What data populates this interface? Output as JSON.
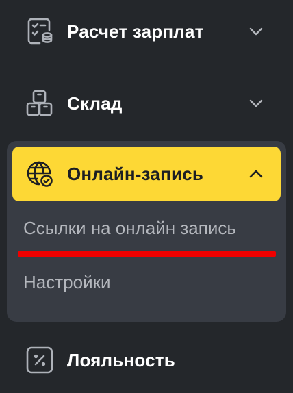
{
  "menu": {
    "salary": {
      "label": "Расчет зарплат",
      "icon": "payroll-list-icon",
      "expanded": false
    },
    "warehouse": {
      "label": "Склад",
      "icon": "boxes-icon",
      "expanded": false
    },
    "booking": {
      "label": "Онлайн-запись",
      "icon": "globe-check-icon",
      "expanded": true,
      "active": true,
      "subitems": [
        {
          "label": "Ссылки на онлайн запись"
        },
        {
          "label": "Настройки"
        }
      ]
    },
    "loyalty": {
      "label": "Лояльность",
      "icon": "percent-badge-icon"
    }
  },
  "colors": {
    "background": "#24272b",
    "group_panel": "#383c44",
    "active_item": "#fdd835",
    "subitem_text": "#b4b7bd",
    "annotation_underline": "#f00000"
  }
}
